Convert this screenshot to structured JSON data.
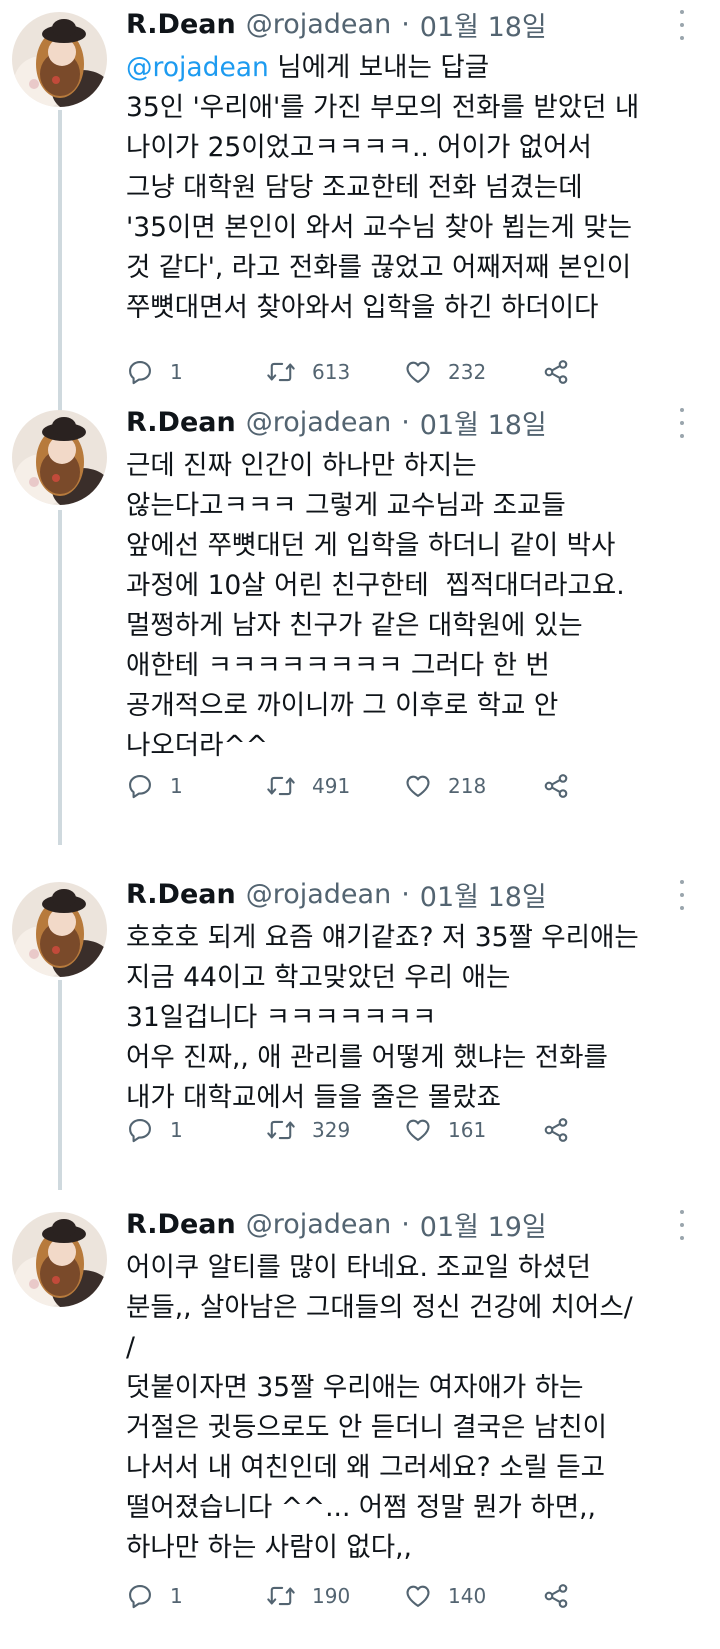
{
  "tweets": [
    {
      "name": "R.Dean",
      "handle": "@rojadean",
      "date": "01월 18일",
      "reply_mention": "@rojadean",
      "reply_suffix": " 님에게 보내는 답글",
      "lines": [
        "35인 '우리애'를 가진 부모의 전화를 받았던 내",
        "나이가 25이었고ㅋㅋㅋㅋ.. 어이가 없어서",
        "그냥 대학원 담당 조교한테 전화 넘겼는데",
        "'35이면 본인이 와서 교수님 찾아 뵙는게 맞는",
        "것 같다', 라고 전화를 끊었고 어째저째 본인이",
        "쭈뼛대면서 찾아와서 입학을 하긴 하더이다"
      ],
      "replies": "1",
      "retweets": "613",
      "likes": "232"
    },
    {
      "name": "R.Dean",
      "handle": "@rojadean",
      "date": "01월 18일",
      "lines": [
        "근데 진짜 인간이 하나만 하지는",
        "않는다고ㅋㅋㅋ 그렇게 교수님과 조교들",
        "앞에선 쭈뼛대던 게 입학을 하더니 같이 박사",
        "과정에 10살 어린 친구한테  찝적대더라고요.",
        "멀쩡하게 남자 친구가 같은 대학원에 있는",
        "애한테 ㅋㅋㅋㅋㅋㅋㅋㅋ 그러다 한 번",
        "공개적으로 까이니까 그 이후로 학교 안",
        "나오더라^^"
      ],
      "replies": "1",
      "retweets": "491",
      "likes": "218"
    },
    {
      "name": "R.Dean",
      "handle": "@rojadean",
      "date": "01월 18일",
      "lines": [
        "호호호 되게 요즘 얘기같죠? 저 35짤 우리애는",
        "지금 44이고 학고맞았던 우리 애는",
        "31일겁니다 ㅋㅋㅋㅋㅋㅋㅋ",
        "어우 진짜,, 애 관리를 어떻게 했냐는 전화를",
        "내가 대학교에서 들을 줄은 몰랐죠"
      ],
      "replies": "1",
      "retweets": "329",
      "likes": "161"
    },
    {
      "name": "R.Dean",
      "handle": "@rojadean",
      "date": "01월 19일",
      "lines": [
        "어이쿠 알티를 많이 타네요. 조교일 하셨던",
        "분들,, 살아남은 그대들의 정신 건강에 치어스/",
        "/",
        "덧붙이자면 35짤 우리애는 여자애가 하는",
        "거절은 귓등으로도 안 듣더니 결국은 남친이",
        "나서서 내 여친인데 왜 그러세요? 소릴 듣고",
        "떨어졌습니다 ^^... 어쩜 정말 뭔가 하면,,",
        "하나만 하는 사람이 없다,,"
      ],
      "replies": "1",
      "retweets": "190",
      "likes": "140"
    }
  ],
  "icons": {
    "reply": "reply-icon",
    "retweet": "retweet-icon",
    "like": "heart-icon",
    "share": "share-icon",
    "more": "more-options-icon"
  },
  "colors": {
    "text": "#0f1419",
    "secondary": "#536471",
    "link": "#1d9bf0",
    "thread_line": "#cfd9de"
  }
}
